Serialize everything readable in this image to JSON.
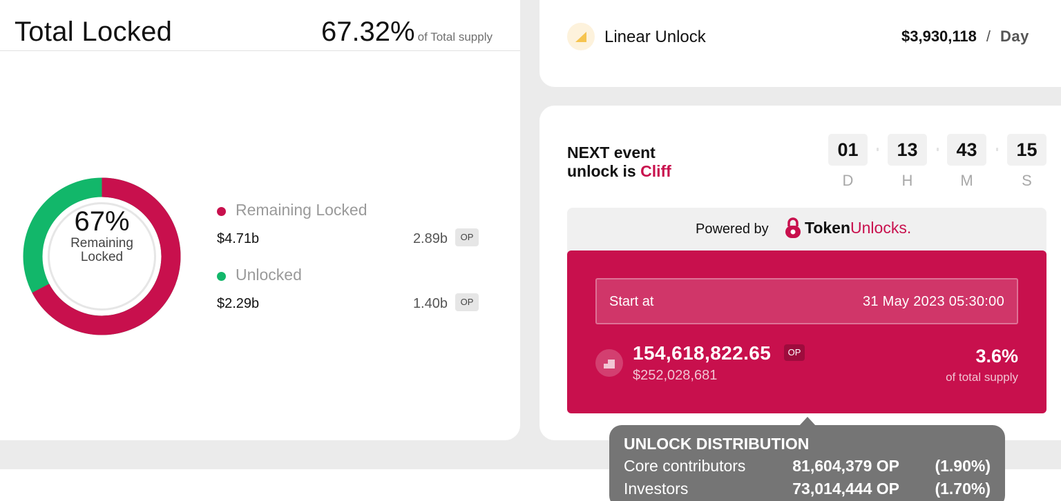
{
  "total_locked": {
    "title": "Total Locked",
    "percent": "67.32%",
    "percent_suffix": "of Total supply"
  },
  "donut": {
    "percent_label": "67%",
    "center_line1": "Remaining",
    "center_line2": "Locked",
    "locked_fraction": 0.6732,
    "locked_color": "#c8104d",
    "unlocked_color": "#12b76a"
  },
  "legend": [
    {
      "name": "Remaining Locked",
      "usd": "$4.71b",
      "amount": "2.89b",
      "token": "OP",
      "color": "#c8104d"
    },
    {
      "name": "Unlocked",
      "usd": "$2.29b",
      "amount": "1.40b",
      "token": "OP",
      "color": "#12b76a"
    }
  ],
  "linear_unlock": {
    "label": "Linear Unlock",
    "rate": "$3,930,118",
    "separator": "/",
    "unit": "Day",
    "icon": "linear-unlock-icon"
  },
  "next_event": {
    "line1": "NEXT event",
    "line2_prefix": "unlock is",
    "type": "Cliff",
    "countdown": [
      {
        "value": "01",
        "unit": "D"
      },
      {
        "value": "13",
        "unit": "H"
      },
      {
        "value": "43",
        "unit": "M"
      },
      {
        "value": "15",
        "unit": "S"
      }
    ]
  },
  "powered_by": {
    "label": "Powered by",
    "brand_part1": "Token",
    "brand_part2": "Unlocks."
  },
  "event": {
    "start_label": "Start at",
    "start_date": "31 May 2023 05:30:00",
    "token_amount": "154,618,822.65",
    "token": "OP",
    "usd_value": "$252,028,681",
    "supply_percent": "3.6%",
    "supply_label": "of total supply",
    "accent": "#c8104d"
  },
  "tooltip": {
    "title": "UNLOCK DISTRIBUTION",
    "rows": [
      {
        "name": "Core contributors",
        "amount": "81,604,379 OP",
        "percent": "(1.90%)"
      },
      {
        "name": "Investors",
        "amount": "73,014,444 OP",
        "percent": "(1.70%)"
      }
    ]
  }
}
